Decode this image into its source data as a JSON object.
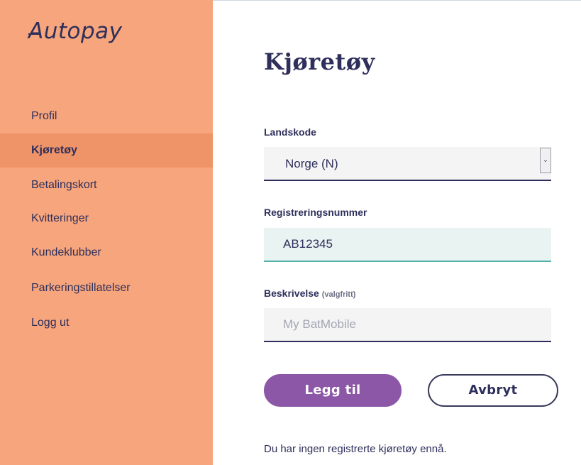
{
  "sidebar": {
    "logo": "Autopay",
    "items": [
      {
        "label": "Profil"
      },
      {
        "label": "Kjøretøy"
      },
      {
        "label": "Betalingskort"
      },
      {
        "label": "Kvitteringer"
      },
      {
        "label": "Kundeklubber"
      },
      {
        "label": "Parkeringstillatelser"
      },
      {
        "label": "Logg ut"
      }
    ],
    "active_index": 1
  },
  "main": {
    "title": "Kjøretøy",
    "country": {
      "label": "Landskode",
      "value": "Norge (N)"
    },
    "registration": {
      "label": "Registreringsnummer",
      "value": "AB12345"
    },
    "description": {
      "label": "Beskrivelse",
      "optional": "(valgfritt)",
      "placeholder": "My BatMobile"
    },
    "buttons": {
      "add": "Legg til",
      "cancel": "Avbryt"
    },
    "empty_message": "Du har ingen registrerte kjøretøy ennå."
  },
  "colors": {
    "sidebar_bg": "#f6a57c",
    "sidebar_active": "#ef9468",
    "text_primary": "#2e2f5b",
    "primary_button": "#8c57a6",
    "input_focus_accent": "#4fb1a9"
  },
  "icons": {
    "select_arrow": "chevron-down-icon",
    "logo_mark": "dash-icon"
  }
}
